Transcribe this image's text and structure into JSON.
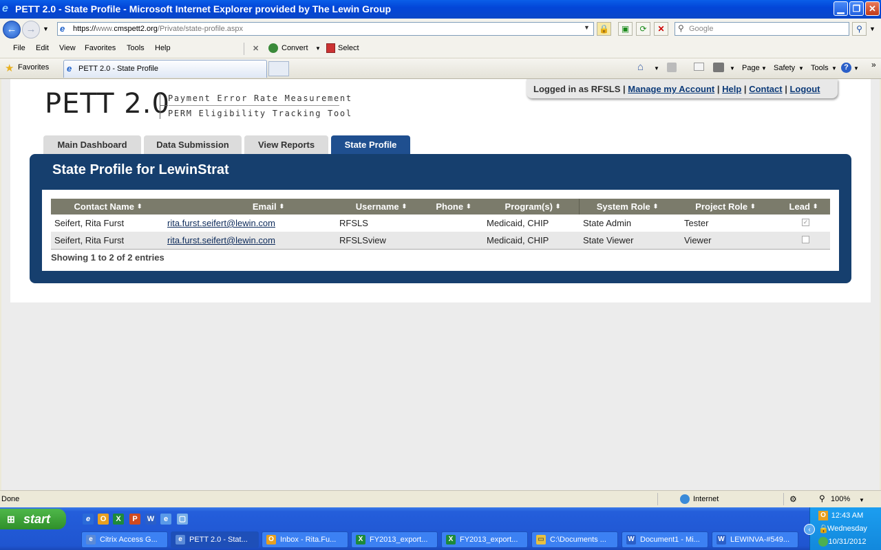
{
  "window": {
    "title": "PETT 2.0 - State Profile - Microsoft Internet Explorer provided by The Lewin Group",
    "minimize_glyph": "▁",
    "restore_glyph": "❐",
    "close_glyph": "✕"
  },
  "address_bar": {
    "scheme": "https://",
    "host_prefix": "www.",
    "host": "cmspett2.org",
    "path": "/Private/state-profile.aspx",
    "search_placeholder": "Google"
  },
  "menu": [
    "File",
    "Edit",
    "View",
    "Favorites",
    "Tools",
    "Help"
  ],
  "toolbar_extra": {
    "close": "✕",
    "convert": "Convert",
    "select": "Select"
  },
  "favorites_bar": {
    "favorites_label": "Favorites",
    "tab_title": "PETT 2.0 - State Profile"
  },
  "command_bar": {
    "page": "Page",
    "safety": "Safety",
    "tools": "Tools"
  },
  "site": {
    "logo": "PETT 2.0",
    "tagline1": "Payment Error Rate Measurement",
    "tagline2": "PERM Eligibility Tracking Tool",
    "logged_in": "Logged in as RFSLS",
    "links": {
      "manage": "Manage my Account",
      "help": "Help",
      "contact": "Contact",
      "logout": "Logout"
    },
    "separator": "|"
  },
  "tabs": [
    "Main Dashboard",
    "Data Submission",
    "View Reports",
    "State Profile"
  ],
  "active_tab": "State Profile",
  "panel": {
    "title": "State Profile for LewinStrat"
  },
  "table": {
    "sort_glyph": "⬍",
    "headers": [
      "Contact Name",
      "Email",
      "Username",
      "Phone",
      "Program(s)",
      "System Role",
      "Project Role",
      "Lead"
    ],
    "rows": [
      {
        "contact": "Seifert, Rita Furst",
        "email": "rita.furst.seifert@lewin.com",
        "username": "RFSLS",
        "phone": "",
        "programs": "Medicaid, CHIP",
        "system_role": "State Admin",
        "project_role": "Tester",
        "lead": true,
        "lead_mark": "✓"
      },
      {
        "contact": "Seifert, Rita Furst",
        "email": "rita.furst.seifert@lewin.com",
        "username": "RFSLSview",
        "phone": "",
        "programs": "Medicaid, CHIP",
        "system_role": "State Viewer",
        "project_role": "Viewer",
        "lead": false,
        "lead_mark": ""
      }
    ],
    "summary": "Showing 1 to 2 of 2 entries"
  },
  "status_bar": {
    "left": "Done",
    "zone": "Internet",
    "zoom": "100%"
  },
  "taskbar": {
    "start": "start",
    "tasks": [
      "Citrix Access G...",
      "PETT 2.0 - Stat...",
      "Inbox - Rita.Fu...",
      "FY2013_export...",
      "FY2013_export...",
      "C:\\Documents ...",
      "Document1 - Mi...",
      "LEWINVA-#549..."
    ],
    "clock": {
      "time": "12:43 AM",
      "day": "Wednesday",
      "date": "10/31/2012"
    }
  },
  "colors": {
    "panel": "#163f6e",
    "active_tab": "#1f4f8f",
    "table_header": "#7b7b6b",
    "link": "#0c3a78"
  }
}
